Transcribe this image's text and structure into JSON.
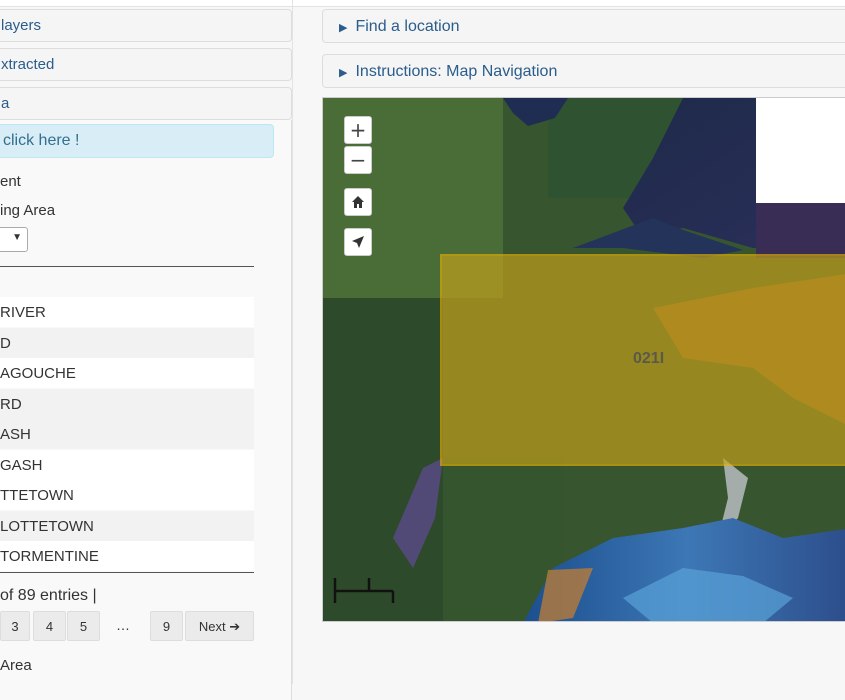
{
  "sidebar": {
    "panel_layers": "layers",
    "panel_extracted": "xtracted",
    "panel_area": "a",
    "info_alert": "click here !",
    "label_1": "ent",
    "label_2": "ing Area",
    "table_rows": [
      "RIVER",
      "D",
      "AGOUCHE",
      "RD",
      "ASH",
      "GASH",
      "TTETOWN",
      "LOTTETOWN",
      "TORMENTINE"
    ],
    "entries_info": "of 89 entries |",
    "pagination": [
      "3",
      "4",
      "5",
      "…",
      "9",
      "Next"
    ],
    "bottom_label": "Area"
  },
  "main": {
    "find_location": "Find a location",
    "instructions": "Instructions: Map Navigation",
    "map_tile_label": "021I"
  },
  "icons": {
    "zoom_in": "plus-icon",
    "zoom_out": "minus-icon",
    "home": "home-icon",
    "locate": "navigation-arrow-icon",
    "next": "arrow-right-icon",
    "expand": "triangle-right-icon"
  },
  "colors": {
    "highlight_fill": "#c9a21a",
    "highlight_border": "#e6b000",
    "link": "#2a5d8c",
    "alert_bg": "#d9edf7"
  }
}
